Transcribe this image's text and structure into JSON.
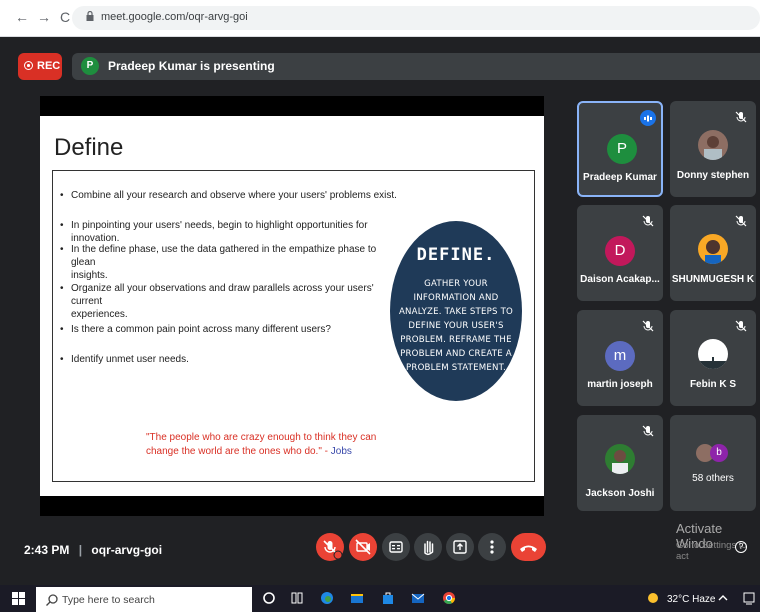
{
  "browser": {
    "url": "meet.google.com/oqr-arvg-goi",
    "back_icon": "←",
    "forward_icon": "→",
    "reload_icon": "C"
  },
  "meeting": {
    "rec_label": "REC",
    "presenter_initial": "P",
    "presenter_text": "Pradeep Kumar is presenting",
    "time": "2:43 PM",
    "separator": "|",
    "code": "oqr-arvg-goi"
  },
  "slide": {
    "title": "Define",
    "bullets": [
      {
        "line1": "Combine all your research and observe where your users' problems exist.",
        "line2": ""
      },
      {
        "line1": "In pinpointing your users' needs, begin to highlight opportunities for innovation.",
        "line2": ""
      },
      {
        "line1": "In the define phase, use the data gathered in the empathize phase to glean",
        "line2": "insights."
      },
      {
        "line1": "Organize all your observations and draw parallels across your users' current",
        "line2": "experiences."
      },
      {
        "line1": "Is there a common pain point across many different users?",
        "line2": ""
      },
      {
        "line1": "Identify unmet user needs.",
        "line2": ""
      }
    ],
    "circle_head": "DEFINE.",
    "circle_body": "GATHER YOUR INFORMATION AND ANALYZE. TAKE STEPS TO DEFINE YOUR USER'S PROBLEM. REFRAME THE PROBLEM AND CREATE A PROBLEM STATEMENT.",
    "quote_text": "\"The people who are crazy enough to think they can change the world are the ones who do.\" -",
    "quote_author": "Jobs"
  },
  "participants": [
    {
      "name": "Pradeep Kumar",
      "initial": "P",
      "color": "#1e8e3e"
    },
    {
      "name": "Donny stephen",
      "initial": "",
      "color": "#8d6e63"
    },
    {
      "name": "Daison Acakap...",
      "initial": "D",
      "color": "#c2185b"
    },
    {
      "name": "SHUNMUGESH K",
      "initial": "",
      "color": "#f9a825"
    },
    {
      "name": "martin joseph",
      "initial": "m",
      "color": "#5c6bc0"
    },
    {
      "name": "Febin K S",
      "initial": "",
      "color": "#ffffff"
    },
    {
      "name": "Jackson Joshi",
      "initial": "",
      "color": "#2e7d32"
    },
    {
      "name": "58 others",
      "initial": "b",
      "color": "#8e24aa"
    }
  ],
  "windows": {
    "activate_title": "Activate Windo",
    "activate_sub": "Go to Settings to act",
    "search_placeholder": "Type here to search",
    "weather": "32°C  Haze"
  }
}
